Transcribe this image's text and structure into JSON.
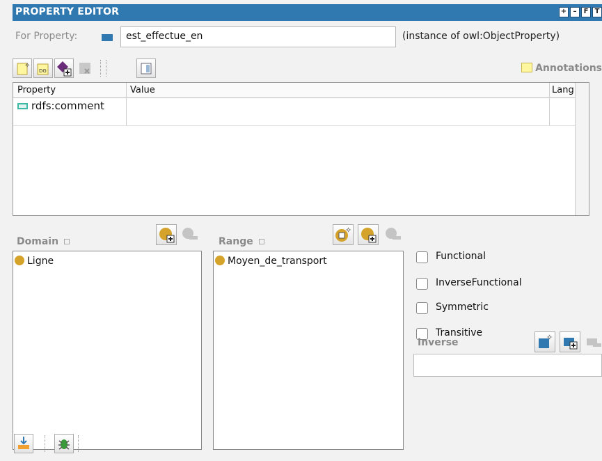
{
  "window": {
    "title": "PROPERTY EDITOR",
    "controls": [
      "add",
      "minimize",
      "float",
      "close"
    ]
  },
  "for_property": {
    "label": "For Property:",
    "value": "est_effectue_en",
    "instance_of": "(instance of owl:ObjectProperty)"
  },
  "toolbar": {
    "icons": [
      "create-annotation-icon",
      "create-datatype-annotation-icon",
      "add-resource-icon",
      "delete-annotation-icon",
      "panel-view-icon"
    ],
    "annotations_label": "Annotations"
  },
  "annotations_table": {
    "columns": [
      "Property",
      "Value",
      "Lang"
    ],
    "rows": [
      {
        "property": "rdfs:comment",
        "value": "",
        "lang": ""
      }
    ]
  },
  "domain": {
    "label": "Domain",
    "items": [
      "Ligne"
    ]
  },
  "range": {
    "label": "Range",
    "items": [
      "Moyen_de_transport"
    ]
  },
  "characteristics": [
    {
      "label": "Functional",
      "checked": false
    },
    {
      "label": "InverseFunctional",
      "checked": false
    },
    {
      "label": "Symmetric",
      "checked": false
    },
    {
      "label": "Transitive",
      "checked": false
    }
  ],
  "inverse": {
    "label": "Inverse",
    "value": ""
  },
  "colors": {
    "titlebar": "#2f78b0",
    "class_dot": "#d6a32a",
    "property_teal": "#3fb9a6"
  }
}
